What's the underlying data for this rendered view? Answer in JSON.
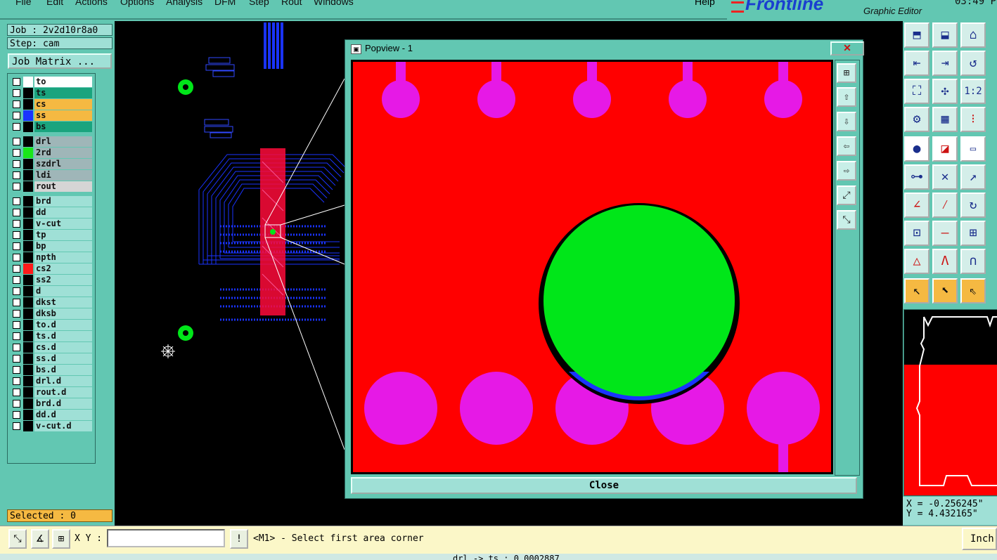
{
  "menubar": {
    "items": [
      "File",
      "Edit",
      "Actions",
      "Options",
      "Analysis",
      "DFM",
      "Step",
      "Rout",
      "Windows"
    ],
    "help": "Help"
  },
  "brand": {
    "logo": "Frontline",
    "subtitle": "Graphic Editor",
    "clock": "03:49 P"
  },
  "left_panel": {
    "job": "Job : 2v2d10r8a0",
    "step": "Step: cam",
    "job_matrix": "Job Matrix ...",
    "layers": [
      {
        "name": "to",
        "color": "#ffffff",
        "bg": "#ffffff"
      },
      {
        "name": "ts",
        "color": "#000000",
        "bg": "#1aa47e"
      },
      {
        "name": "cs",
        "color": "#000000",
        "bg": "#f5b942"
      },
      {
        "name": "ss",
        "color": "#1a33ff",
        "bg": "#f5b942"
      },
      {
        "name": "bs",
        "color": "#000000",
        "bg": "#1aa47e"
      },
      {
        "name": "drl",
        "color": "#000000",
        "bg": "#9fb6b8"
      },
      {
        "name": "2rd",
        "color": "#19e619",
        "bg": "#9fb6b8"
      },
      {
        "name": "szdrl",
        "color": "#000000",
        "bg": "#9fb6b8"
      },
      {
        "name": "ldi",
        "color": "#000000",
        "bg": "#9fb6b8"
      },
      {
        "name": "rout",
        "color": "#000000",
        "bg": "#d5d5d5"
      },
      {
        "name": "brd",
        "color": "#000000",
        "bg": "#9fe0d6"
      },
      {
        "name": "dd",
        "color": "#000000",
        "bg": "#9fe0d6"
      },
      {
        "name": "v-cut",
        "color": "#000000",
        "bg": "#9fe0d6"
      },
      {
        "name": "tp",
        "color": "#000000",
        "bg": "#9fe0d6"
      },
      {
        "name": "bp",
        "color": "#000000",
        "bg": "#9fe0d6"
      },
      {
        "name": "npth",
        "color": "#000000",
        "bg": "#9fe0d6"
      },
      {
        "name": "cs2",
        "color": "#ff1a1a",
        "bg": "#9fe0d6"
      },
      {
        "name": "ss2",
        "color": "#000000",
        "bg": "#9fe0d6"
      },
      {
        "name": "d",
        "color": "#000000",
        "bg": "#9fe0d6"
      },
      {
        "name": "dkst",
        "color": "#000000",
        "bg": "#9fe0d6"
      },
      {
        "name": "dksb",
        "color": "#000000",
        "bg": "#9fe0d6"
      },
      {
        "name": "to.d",
        "color": "#000000",
        "bg": "#9fe0d6"
      },
      {
        "name": "ts.d",
        "color": "#000000",
        "bg": "#9fe0d6"
      },
      {
        "name": "cs.d",
        "color": "#000000",
        "bg": "#9fe0d6"
      },
      {
        "name": "ss.d",
        "color": "#000000",
        "bg": "#9fe0d6"
      },
      {
        "name": "bs.d",
        "color": "#000000",
        "bg": "#9fe0d6"
      },
      {
        "name": "drl.d",
        "color": "#000000",
        "bg": "#9fe0d6"
      },
      {
        "name": "rout.d",
        "color": "#000000",
        "bg": "#9fe0d6"
      },
      {
        "name": "brd.d",
        "color": "#000000",
        "bg": "#9fe0d6"
      },
      {
        "name": "dd.d",
        "color": "#000000",
        "bg": "#9fe0d6"
      },
      {
        "name": "v-cut.d",
        "color": "#000000",
        "bg": "#9fe0d6"
      }
    ],
    "selected": "Selected : 0"
  },
  "popview": {
    "title": "Popview - 1",
    "close_label": "Close",
    "close_x": "✕"
  },
  "coords": {
    "x": "X = -0.256245\"",
    "y": "Y = 4.432165\""
  },
  "bottom": {
    "xy_label": "X Y :",
    "xy_value": "",
    "prompt": "<M1> - Select first area corner",
    "units": "Inch"
  },
  "status": {
    "text": "drl -> ts : 0.0002887"
  },
  "colors": {
    "panel": "#62c7b2",
    "copper": "#ff0000",
    "pad": "#e619e6",
    "drill": "#00e619",
    "trace": "#1a33ff"
  }
}
